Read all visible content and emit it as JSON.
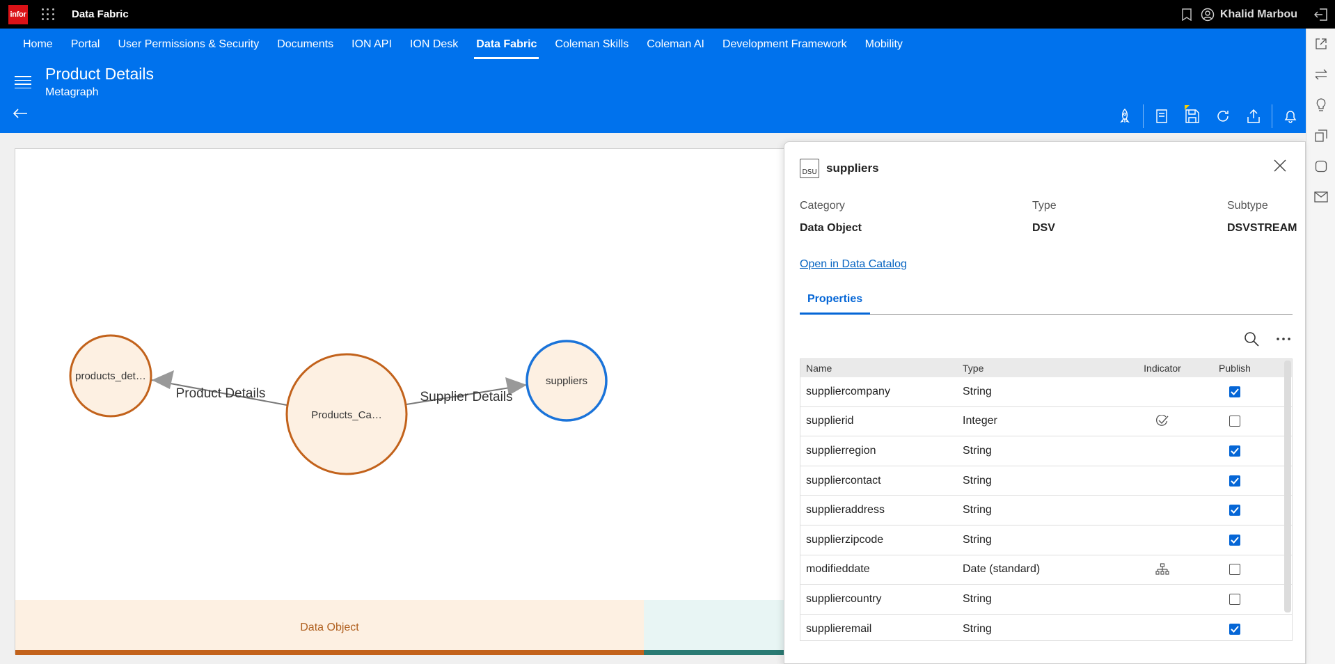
{
  "topbar": {
    "logo_text": "infor",
    "app_title": "Data Fabric",
    "user_name": "Khalid Marbou",
    "icons": [
      "app-grid-icon",
      "bookmark-icon",
      "user-icon",
      "logout-icon"
    ]
  },
  "nav": {
    "items": [
      {
        "label": "Home"
      },
      {
        "label": "Portal"
      },
      {
        "label": "User Permissions & Security"
      },
      {
        "label": "Documents"
      },
      {
        "label": "ION API"
      },
      {
        "label": "ION Desk"
      },
      {
        "label": "Data Fabric",
        "active": true
      },
      {
        "label": "Coleman Skills"
      },
      {
        "label": "Coleman AI"
      },
      {
        "label": "Development Framework"
      },
      {
        "label": "Mobility"
      }
    ]
  },
  "header": {
    "title": "Product Details",
    "subtitle": "Metagraph",
    "toolbar_icons": [
      "rocket-icon",
      "notes-icon",
      "save-icon",
      "refresh-icon",
      "upload-icon",
      "notification-icon"
    ]
  },
  "rail": {
    "icons": [
      "external-link-icon",
      "swap-icon",
      "lightbulb-icon",
      "copy-icon",
      "square-icon",
      "mail-icon"
    ]
  },
  "graph": {
    "nodes": [
      {
        "id": "products_det",
        "label": "products_det…",
        "kind": "data-object"
      },
      {
        "id": "products_ca",
        "label": "Products_Ca…",
        "kind": "data-object"
      },
      {
        "id": "suppliers",
        "label": "suppliers",
        "kind": "selected"
      }
    ],
    "edges": [
      {
        "from": "products_ca",
        "to": "products_det",
        "label": "Product Details"
      },
      {
        "from": "products_ca",
        "to": "suppliers",
        "label": "Supplier Details"
      }
    ],
    "legend": [
      {
        "label": "Data Object",
        "color": "#c2621b",
        "bg": "#fdf0e2"
      },
      {
        "label": "",
        "color": "#2a7a73",
        "bg": "#e8f5f4"
      }
    ]
  },
  "panel": {
    "name": "suppliers",
    "icon_text": "DSU",
    "category_label": "Category",
    "category_value": "Data Object",
    "type_label": "Type",
    "type_value": "DSV",
    "subtype_label": "Subtype",
    "subtype_value": "DSVSTREAM",
    "catalog_link": "Open in Data Catalog",
    "tab": "Properties",
    "columns": {
      "name": "Name",
      "type": "Type",
      "indicator": "Indicator",
      "publish": "Publish"
    },
    "rows": [
      {
        "name": "suppliercompany",
        "type": "String",
        "indicator": "",
        "publish": true
      },
      {
        "name": "supplierid",
        "type": "Integer",
        "indicator": "key-check-icon",
        "publish": false
      },
      {
        "name": "supplierregion",
        "type": "String",
        "indicator": "",
        "publish": true
      },
      {
        "name": "suppliercontact",
        "type": "String",
        "indicator": "",
        "publish": true
      },
      {
        "name": "supplieraddress",
        "type": "String",
        "indicator": "",
        "publish": true
      },
      {
        "name": "supplierzipcode",
        "type": "String",
        "indicator": "",
        "publish": true
      },
      {
        "name": "modifieddate",
        "type": "Date (standard)",
        "indicator": "hierarchy-icon",
        "publish": false
      },
      {
        "name": "suppliercountry",
        "type": "String",
        "indicator": "",
        "publish": false
      },
      {
        "name": "supplieremail",
        "type": "String",
        "indicator": "",
        "publish": true
      }
    ]
  },
  "colors": {
    "header_blue": "#0072ed",
    "accent_blue": "#0566d6",
    "node_orange": "#c2621b",
    "node_fill": "#fdf0e2",
    "node_blue": "#1a73d9"
  }
}
